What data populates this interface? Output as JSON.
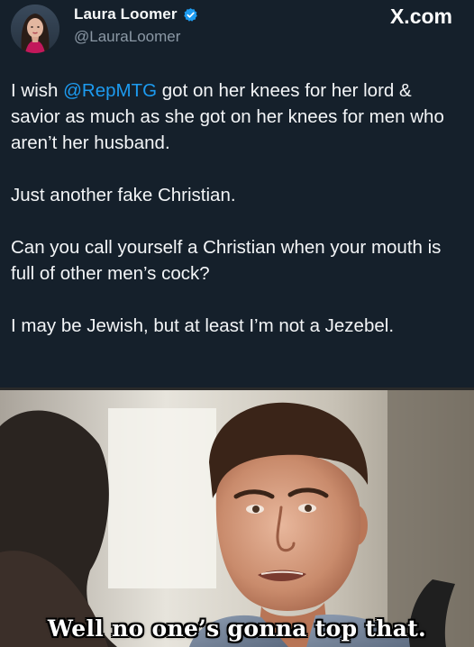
{
  "tweet": {
    "display_name": "Laura Loomer",
    "handle": "@LauraLoomer",
    "verified": true,
    "brand": "X.com",
    "paragraphs": {
      "p1_mention": "@RepMTG",
      "p1_before": "I wish ",
      "p1_after": " got on her knees for her lord & savior as much as she got on her knees for men who aren’t her husband.",
      "p2": "Just another fake Christian.",
      "p3": "Can you call yourself a Christian when your mouth is full of other men’s cock?",
      "p4": "I may be Jewish, but at least I’m not a Jezebel."
    },
    "colors": {
      "background": "#15202b",
      "text": "#f3f5f7",
      "mention": "#1d9bf0",
      "handle": "#8b98a5",
      "verified": "#1d9bf0"
    },
    "icons": {
      "verified": "verified-badge-icon",
      "brand": "x-logo-icon"
    }
  },
  "meme": {
    "caption": "Well no one’s gonna top that."
  }
}
